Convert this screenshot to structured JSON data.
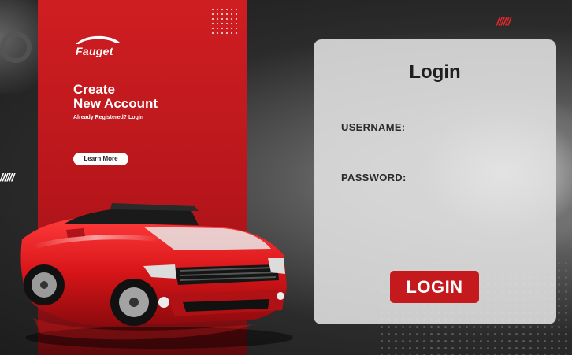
{
  "brand": {
    "name": "Fauget"
  },
  "promo": {
    "title_line1": "Create",
    "title_line2": "New Account",
    "subtitle": "Already Registered? Login",
    "cta_label": "Learn More"
  },
  "decor": {
    "slashes": "//////"
  },
  "login": {
    "heading": "Login",
    "username_label": "USERNAME:",
    "username_value": "",
    "password_label": "PASSWORD:",
    "password_value": "",
    "submit_label": "LOGIN"
  },
  "colors": {
    "accent_red": "#c4191d",
    "panel_red": "#cf1e22",
    "card_bg": "#e2e2e2",
    "text_dark": "#1e1e1e"
  },
  "icons": [
    "car-logo-icon",
    "sports-car-image"
  ]
}
